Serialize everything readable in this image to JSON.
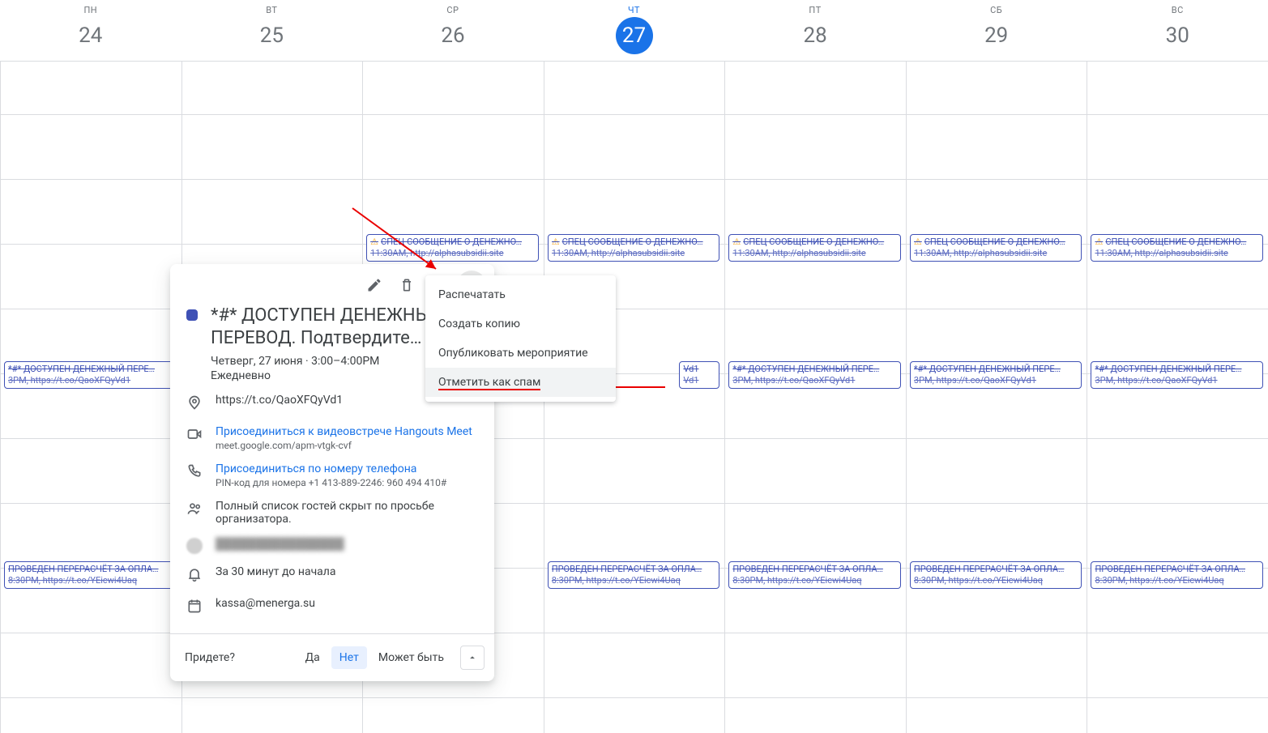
{
  "days": [
    {
      "dow": "ПН",
      "num": "24",
      "today": false
    },
    {
      "dow": "ВТ",
      "num": "25",
      "today": false
    },
    {
      "dow": "СР",
      "num": "26",
      "today": false
    },
    {
      "dow": "ЧТ",
      "num": "27",
      "today": true
    },
    {
      "dow": "ПТ",
      "num": "28",
      "today": false
    },
    {
      "dow": "СБ",
      "num": "29",
      "today": false
    },
    {
      "dow": "ВС",
      "num": "30",
      "today": false
    }
  ],
  "spam_event_1": {
    "title": "СПЕЦ СООБЩЕНИЕ О ДЕНЕЖНО…",
    "sub": "11:30AM, http://alphasubsidii.site"
  },
  "spam_event_2": {
    "title": "*#* ДОСТУПЕН ДЕНЕЖНЫЙ ПЕРЕ…",
    "sub": "3PM, https://t.co/QaoXFQyVd1"
  },
  "spam_event_2_partial": {
    "title": "Vd1",
    "sub": "Vd1"
  },
  "spam_event_3": {
    "title": "ПРОВЕДЕН ПЕРЕРАСЧЁТ ЗА ОПЛА…",
    "sub": "8:30PM, https://t.co/YEicwi4Uaq"
  },
  "popup": {
    "title": "*#* ДОСТУПЕН ДЕНЕЖНЫЙ ПЕРЕВОД. Подтвердите…",
    "time_line": "Четверг, 27 июня · 3:00–4:00PM",
    "recurrence": "Ежедневно",
    "location": "https://t.co/QaoXFQyVd1",
    "meet_link": "Присоединиться к видеовстрече Hangouts Meet",
    "meet_sub": "meet.google.com/apm-vtgk-cvf",
    "phone_link": "Присоединиться по номеру телефона",
    "phone_sub": "PIN-код для номера +1 413-889-2246: 960 494 410#",
    "guests": "Полный список гостей скрыт по просьбе организатора.",
    "organizer_hidden": "████████████████",
    "reminder": "За 30 минут до начала",
    "email": "kassa@menerga.su",
    "footer_label": "Придете?",
    "rsvp_yes": "Да",
    "rsvp_no": "Нет",
    "rsvp_maybe": "Может быть"
  },
  "menu": {
    "print": "Распечатать",
    "copy": "Создать копию",
    "publish": "Опубликовать мероприятие",
    "spam": "Отметить как спам"
  },
  "colors": {
    "accent": "#1a73e8",
    "event_border": "#3f51b5"
  }
}
